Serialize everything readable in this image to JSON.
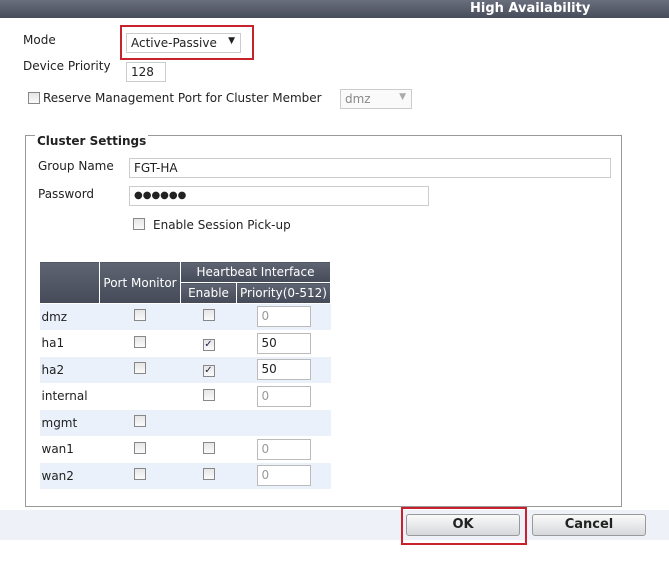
{
  "header": {
    "title": "High Availability"
  },
  "form": {
    "mode_label": "Mode",
    "mode_value": "Active-Passive",
    "priority_label": "Device Priority",
    "priority_value": "128",
    "reserve_label": "Reserve Management Port for Cluster Member",
    "reserve_checked": false,
    "reserve_port": "dmz"
  },
  "cluster": {
    "legend": "Cluster Settings",
    "group_label": "Group Name",
    "group_value": "FGT-HA",
    "password_label": "Password",
    "password_value": "●●●●●●",
    "session_label": "Enable Session Pick-up",
    "session_checked": false
  },
  "table": {
    "headers": {
      "port_monitor": "Port Monitor",
      "heartbeat": "Heartbeat Interface",
      "enable": "Enable",
      "priority": "Priority(0-512)"
    },
    "rows": [
      {
        "name": "dmz",
        "monitor": false,
        "enable": false,
        "priority": "0"
      },
      {
        "name": "ha1",
        "monitor": false,
        "enable": true,
        "priority": "50"
      },
      {
        "name": "ha2",
        "monitor": false,
        "enable": true,
        "priority": "50"
      },
      {
        "name": "internal",
        "monitor": null,
        "enable": false,
        "priority": "0"
      },
      {
        "name": "mgmt",
        "monitor": false,
        "enable": null,
        "priority": null
      },
      {
        "name": "wan1",
        "monitor": false,
        "enable": false,
        "priority": "0"
      },
      {
        "name": "wan2",
        "monitor": false,
        "enable": false,
        "priority": "0"
      }
    ]
  },
  "buttons": {
    "ok": "OK",
    "cancel": "Cancel"
  },
  "colors": {
    "highlight": "#c8232c",
    "header": "#4f5462"
  }
}
